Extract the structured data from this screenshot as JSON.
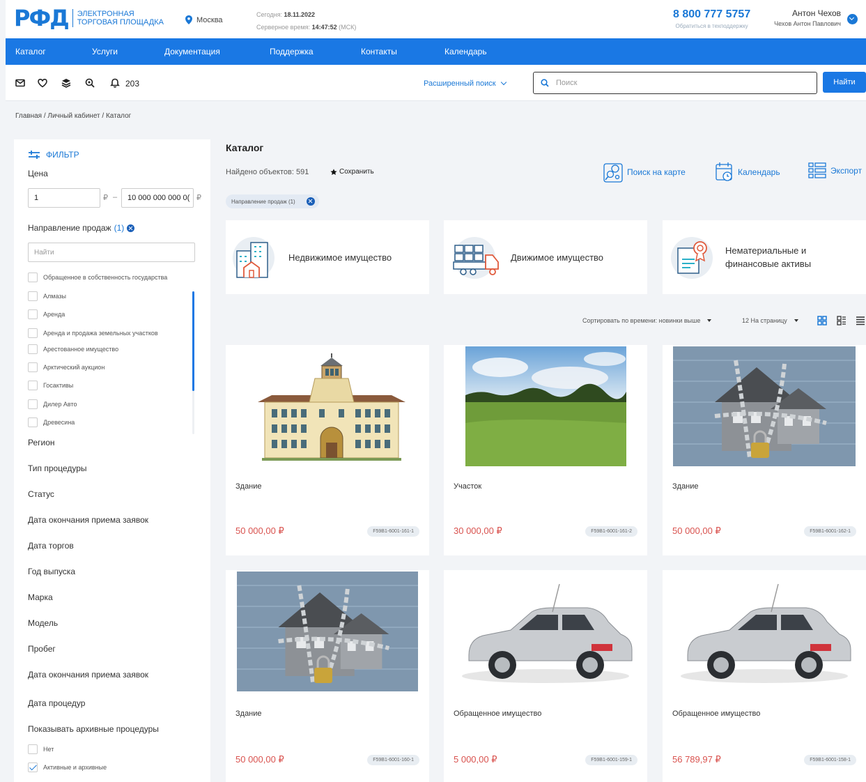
{
  "header": {
    "logo_mark": "РФД",
    "logo_line1": "ЭЛЕКТРОННАЯ",
    "logo_line2": "ТОРГОВАЯ ПЛОЩАДКА",
    "city": "Москва",
    "today_label": "Сегодня:",
    "today_value": "18.11.2022",
    "server_label": "Серверное время:",
    "server_value": "14:47:52",
    "server_tz": "(МСК)",
    "phone": "8 800 777 5757",
    "support": "Обратиться в техподдержку",
    "user_short": "Антон Чехов",
    "user_full": "Чехов Антон Павлович"
  },
  "nav": [
    "Каталог",
    "Услуги",
    "Документация",
    "Поддержка",
    "Контакты",
    "Календарь"
  ],
  "toolbar": {
    "notifications": "203",
    "advanced_search": "Расширенный поиск",
    "search_placeholder": "Поиск",
    "find_button": "Найти"
  },
  "breadcrumbs": "Главная  /  Личный кабинет  /  Каталог",
  "filter": {
    "title": "ФИЛЬТР",
    "price_label": "Цена",
    "price_from": "1",
    "price_to": "10 000 000 000 0(",
    "currency": "₽",
    "dash": "–",
    "direction_label": "Направление продаж",
    "direction_count": "(1)",
    "direction_search": "Найти",
    "options": [
      "Обращенное в собственность государства",
      "Алмазы",
      "Аренда",
      "Аренда и продажа земельных участков",
      "Арестованное имущество",
      "Арктический аукцион",
      "Госактивы",
      "Дилер Авто",
      "Древесина"
    ],
    "sections": [
      "Регион",
      "Тип процедуры",
      "Статус",
      "Дата окончания приема заявок",
      "Дата торгов",
      "Год выпуска",
      "Марка",
      "Модель",
      "Пробег",
      "Дата окончания приема заявок",
      "Дата процедур",
      "Показывать архивные процедуры"
    ],
    "archive_options": [
      "Нет",
      "Активные и архивные"
    ]
  },
  "catalog": {
    "title": "Каталог",
    "found": "Найдено объектов: 591",
    "save": "Сохранить",
    "map_search": "Поиск на карте",
    "calendar": "Календарь",
    "export": "Экспорт",
    "chip": "Направление продаж (1)",
    "categories": [
      "Недвижимое имущество",
      "Движимое имущество",
      "Нематериальные и финансовые активы"
    ],
    "sort": "Сортировать по времени: новинки выше",
    "per_page": "12 На страницу",
    "cards": [
      {
        "title": "Здание",
        "price": "50 000,00 ₽",
        "lot": "F59B1-6001-161-1",
        "image": "building"
      },
      {
        "title": "Участок",
        "price": "30 000,00 ₽",
        "lot": "F59B1-6001-161-2",
        "image": "field"
      },
      {
        "title": "Здание",
        "price": "50 000,00 ₽",
        "lot": "F59B1-6001-162-1",
        "image": "chained-house"
      },
      {
        "title": "Здание",
        "price": "50 000,00 ₽",
        "lot": "F59B1-6001-160-1",
        "image": "chained-house"
      },
      {
        "title": "Обращенное имущество",
        "price": "5 000,00 ₽",
        "lot": "F59B1-6001-159-1",
        "image": "car"
      },
      {
        "title": "Обращенное имущество",
        "price": "56 789,97 ₽",
        "lot": "F59B1-6001-158-1",
        "image": "car"
      }
    ]
  },
  "colors": {
    "accent": "#1a78e4",
    "price": "#d9534f"
  }
}
